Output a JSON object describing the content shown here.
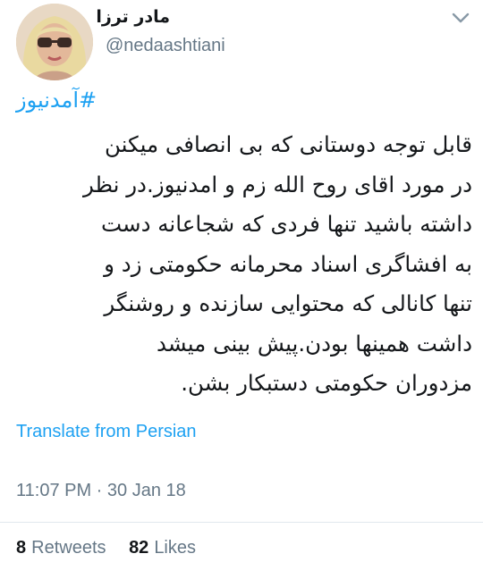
{
  "user": {
    "display_name": "مادر ترزا",
    "handle": "@nedaashtiani"
  },
  "tweet": {
    "hashtag": "#آمدنیوز",
    "lines": [
      "قابل توجه دوستانی که بی انصافی میکنن",
      "در مورد اقای روح الله زم و امدنیوز.در نظر",
      "داشته باشید تنها فردی که شجاعانه دست",
      "به افشاگری اسناد محرمانه حکومتی زد و",
      "تنها کانالی که محتوایی سازنده و روشنگر",
      "داشت همینها بودن.پیش بینی میشد",
      "مزدوران حکومتی دستبکار بشن."
    ],
    "translate_label": "Translate from Persian",
    "timestamp": "11:07 PM · 30 Jan 18"
  },
  "stats": {
    "retweets_count": "8",
    "retweets_label": "Retweets",
    "likes_count": "82",
    "likes_label": "Likes"
  },
  "icons": {
    "menu": "chevron-down-icon"
  },
  "colors": {
    "link": "#1da1f2",
    "muted": "#657786",
    "text": "#14171a",
    "divider": "#e1e8ed"
  }
}
